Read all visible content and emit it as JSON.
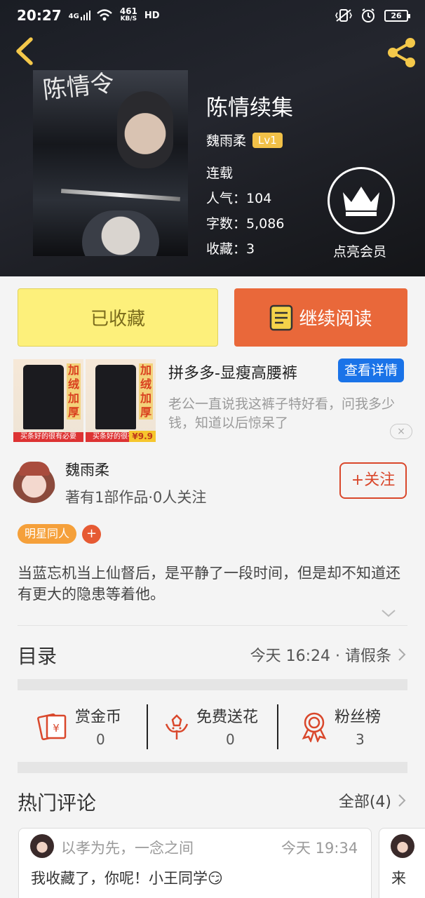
{
  "status_bar": {
    "time": "20:27",
    "network": "4G",
    "speed_value": "461",
    "speed_unit": "KB/S",
    "hd": "HD",
    "battery": "26"
  },
  "book": {
    "title": "陈情续集",
    "author": "魏雨柔",
    "level": "Lv1",
    "status": "连载",
    "popularity_label": "人气：",
    "popularity": "104",
    "words_label": "字数：",
    "words": "5,086",
    "favorites_label": "收藏：",
    "favorites": "3",
    "cover_title": "陈情令"
  },
  "vip": {
    "label": "点亮会员"
  },
  "actions": {
    "collected_label": "已收藏",
    "continue_label": "继续阅读"
  },
  "ad": {
    "title": "拼多多-显瘦高腰裤",
    "button": "查看详情",
    "description": "老公一直说我这裤子特好看，问我多少钱，知道以后惊呆了",
    "image_text": "加绒加厚",
    "image_caption": "买条好的很有必要",
    "price": "¥9.9",
    "close": "×"
  },
  "author_card": {
    "name": "魏雨柔",
    "stats": "著有1部作品·0人关注",
    "follow_button": "+关注"
  },
  "tags": {
    "items": [
      "明星同人"
    ],
    "add": "+"
  },
  "synopsis": "当蓝忘机当上仙督后，是平静了一段时间，但是却不知道还有更大的隐患等着他。",
  "toc": {
    "title": "目录",
    "latest": "今天 16:24 · 请假条"
  },
  "stats": [
    {
      "label": "赏金币",
      "value": "0",
      "icon": "coin-envelope-icon"
    },
    {
      "label": "免费送花",
      "value": "0",
      "icon": "flower-icon"
    },
    {
      "label": "粉丝榜",
      "value": "3",
      "icon": "medal-icon"
    }
  ],
  "comments": {
    "title": "热门评论",
    "all_label": "全部(4)",
    "items": [
      {
        "user": "以孝为先，一念之间",
        "time": "今天 19:34",
        "text": "我收藏了，你呢！小王同学😏"
      },
      {
        "user": "",
        "time": "",
        "text": "来"
      }
    ]
  },
  "colors": {
    "accent_orange": "#e9683a",
    "collected_yellow": "#fdf07b",
    "ad_blue": "#1a73e8",
    "follow_red": "#d9472b",
    "tag_orange": "#f5a03a",
    "icon_red": "#d9472b"
  }
}
